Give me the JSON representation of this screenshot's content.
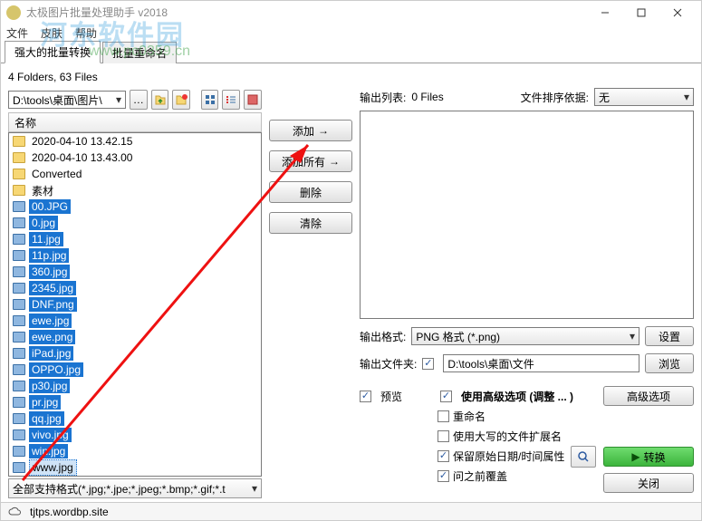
{
  "titlebar": {
    "title": "太极图片批量处理助手  v2018"
  },
  "menu": {
    "file": "文件",
    "skin": "皮肤",
    "help": "帮助"
  },
  "tabs": {
    "convert": "强大的批量转换",
    "rename": "批量重命名"
  },
  "status": {
    "folders_files": "4 Folders, 63 Files"
  },
  "path": {
    "value": "D:\\tools\\桌面\\图片\\"
  },
  "listheader": {
    "name": "名称"
  },
  "files": [
    {
      "type": "folder",
      "name": "2020-04-10 13.42.15",
      "sel": false
    },
    {
      "type": "folder",
      "name": "2020-04-10 13.43.00",
      "sel": false
    },
    {
      "type": "folder",
      "name": "Converted",
      "sel": false
    },
    {
      "type": "folder",
      "name": "素材",
      "sel": false
    },
    {
      "type": "file",
      "name": "00.JPG",
      "sel": true
    },
    {
      "type": "file",
      "name": "0.jpg",
      "sel": true
    },
    {
      "type": "file",
      "name": "11.jpg",
      "sel": true
    },
    {
      "type": "file",
      "name": "11p.jpg",
      "sel": true
    },
    {
      "type": "file",
      "name": "360.jpg",
      "sel": true
    },
    {
      "type": "file",
      "name": "2345.jpg",
      "sel": true
    },
    {
      "type": "file",
      "name": "DNF.png",
      "sel": true
    },
    {
      "type": "file",
      "name": "ewe.jpg",
      "sel": true
    },
    {
      "type": "file",
      "name": "ewe.png",
      "sel": true
    },
    {
      "type": "file",
      "name": "iPad.jpg",
      "sel": true
    },
    {
      "type": "file",
      "name": "OPPO.jpg",
      "sel": true
    },
    {
      "type": "file",
      "name": "p30.jpg",
      "sel": true
    },
    {
      "type": "file",
      "name": "pr.jpg",
      "sel": true
    },
    {
      "type": "file",
      "name": "qq.jpg",
      "sel": true
    },
    {
      "type": "file",
      "name": "vivo.jpg",
      "sel": true
    },
    {
      "type": "file",
      "name": "win.jpg",
      "sel": true
    },
    {
      "type": "file",
      "name": "www.jpg",
      "sel": false,
      "partial": true
    }
  ],
  "mid": {
    "add": "添加",
    "add_all": "添加所有",
    "remove": "删除",
    "clear": "清除"
  },
  "right": {
    "output_list_label": "输出列表:",
    "output_list_count": "0 Files",
    "sort_label": "文件排序依据:",
    "sort_value": "无",
    "out_format_label": "输出格式:",
    "out_format_value": "PNG 格式  (*.png)",
    "settings": "设置",
    "out_folder_label": "输出文件夹:",
    "out_folder_value": "D:\\tools\\桌面\\文件",
    "browse": "浏览",
    "preview": "预览",
    "advanced_check": "使用高级选项 (调整 ... )",
    "advanced_btn": "高级选项",
    "opt_rename": "重命名",
    "opt_uppercase": "使用大写的文件扩展名",
    "opt_keep_date": "保留原始日期/时间属性",
    "opt_overwrite": "问之前覆盖",
    "convert_btn": "转换",
    "close_btn": "关闭"
  },
  "formatbar": {
    "text": "全部支持格式(*.jpg;*.jpe;*.jpeg;*.bmp;*.gif;*.t"
  },
  "statusbar": {
    "url": "tjtps.wordbp.site"
  },
  "watermark": {
    "line1": "河东软件园",
    "line2": "www.pc0359.cn"
  }
}
